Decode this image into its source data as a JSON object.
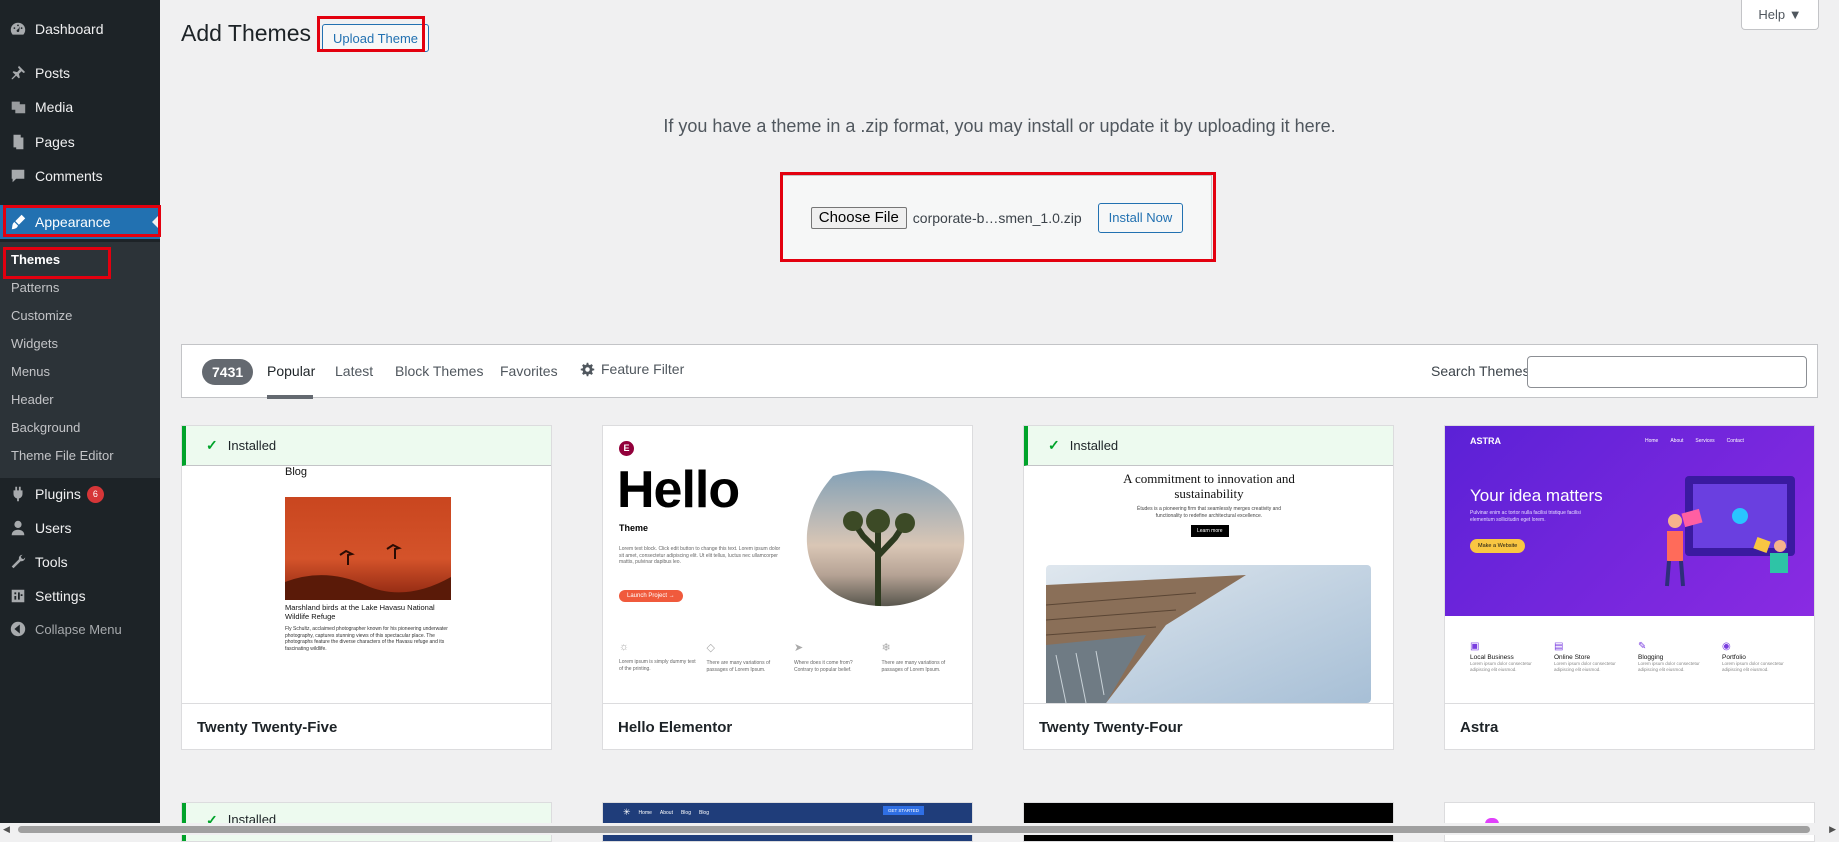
{
  "sidebar": {
    "items": [
      {
        "label": "Dashboard",
        "icon": "dashboard-icon"
      },
      {
        "label": "Posts",
        "icon": "pin-icon"
      },
      {
        "label": "Media",
        "icon": "media-icon"
      },
      {
        "label": "Pages",
        "icon": "pages-icon"
      },
      {
        "label": "Comments",
        "icon": "comments-icon"
      },
      {
        "label": "Appearance",
        "icon": "brush-icon"
      },
      {
        "label": "Plugins",
        "icon": "plugin-icon",
        "badge": "6"
      },
      {
        "label": "Users",
        "icon": "users-icon"
      },
      {
        "label": "Tools",
        "icon": "wrench-icon"
      },
      {
        "label": "Settings",
        "icon": "settings-icon"
      }
    ],
    "submenu": [
      "Themes",
      "Patterns",
      "Customize",
      "Widgets",
      "Menus",
      "Header",
      "Background",
      "Theme File Editor"
    ],
    "collapse_label": "Collapse Menu"
  },
  "header": {
    "title": "Add Themes",
    "upload_button": "Upload Theme",
    "help": "Help ▼"
  },
  "upload": {
    "description": "If you have a theme in a .zip format, you may install or update it by uploading it here.",
    "choose_file": "Choose File",
    "file_name": "corporate-b…smen_1.0.zip",
    "install_button": "Install Now"
  },
  "filter": {
    "count": "7431",
    "tabs": [
      "Popular",
      "Latest",
      "Block Themes",
      "Favorites"
    ],
    "feature_filter": "Feature Filter",
    "search_label": "Search Themes",
    "search_value": ""
  },
  "themes": [
    {
      "name": "Twenty Twenty-Five",
      "installed": "Installed",
      "preview": {
        "heading": "Blog",
        "caption": "Marshland birds at the Lake Havasu National Wildlife Refuge",
        "body": "Fly Schultz, acclaimed photographer known for his pioneering underwater photography, captures stunning views of this spectacular place. The photographs feature the diverse characters of the Havasu refuge and its fascinating wildlife."
      }
    },
    {
      "name": "Hello Elementor",
      "preview": {
        "logo": "E",
        "big": "Hello",
        "sub": "Theme",
        "text": "Lorem text block. Click edit button to change this text. Lorem ipsum dolor sit amet, consectetur adipiscing elit. Ut elit tellus, luctus nec ullamcorper mattis, pulvinar dapibus leo.",
        "button": "Launch Project →",
        "features": [
          "Lorem ipsum is simply dummy text of the printing.",
          "There are many variations of passages of Lorem Ipsum.",
          "Where does it come from? Contrary to popular belief.",
          "There are many variations of passages of Lorem Ipsum."
        ]
      }
    },
    {
      "name": "Twenty Twenty-Four",
      "installed": "Installed",
      "preview": {
        "heading": "A commitment to innovation and sustainability",
        "text": "Études is a pioneering firm that seamlessly merges creativity and functionality to redefine architectural excellence.",
        "button": "Learn more"
      }
    },
    {
      "name": "Astra",
      "preview": {
        "logo": "ASTRA",
        "nav": [
          "Home",
          "About",
          "Services",
          "Contact"
        ],
        "headline": "Your idea matters",
        "text": "Pulvinar enim ac tortor nulla facilisi tristique facilisi elementum sollicitudin eget lorem.",
        "button": "Make a Website",
        "features": [
          {
            "title": "Local Business",
            "text": "Lorem ipsum dolor consectetur adipiscing elit eiusmod."
          },
          {
            "title": "Online Store",
            "text": "Lorem ipsum dolor consectetur adipiscing elit eiusmod."
          },
          {
            "title": "Blogging",
            "text": "Lorem ipsum dolor consectetur adipiscing elit eiusmod."
          },
          {
            "title": "Portfolio",
            "text": "Lorem ipsum dolor consectetur adipiscing elit eiusmod."
          }
        ]
      }
    }
  ],
  "row2": {
    "installed": "Installed",
    "nav": [
      "Home",
      "About",
      "Blog",
      "Blog"
    ],
    "cta": "GET STARTED"
  },
  "colors": {
    "sidebar_bg": "#1d2327",
    "accent": "#2271b1",
    "highlight_box": "#e3000f",
    "installed_green": "#00a32a"
  }
}
